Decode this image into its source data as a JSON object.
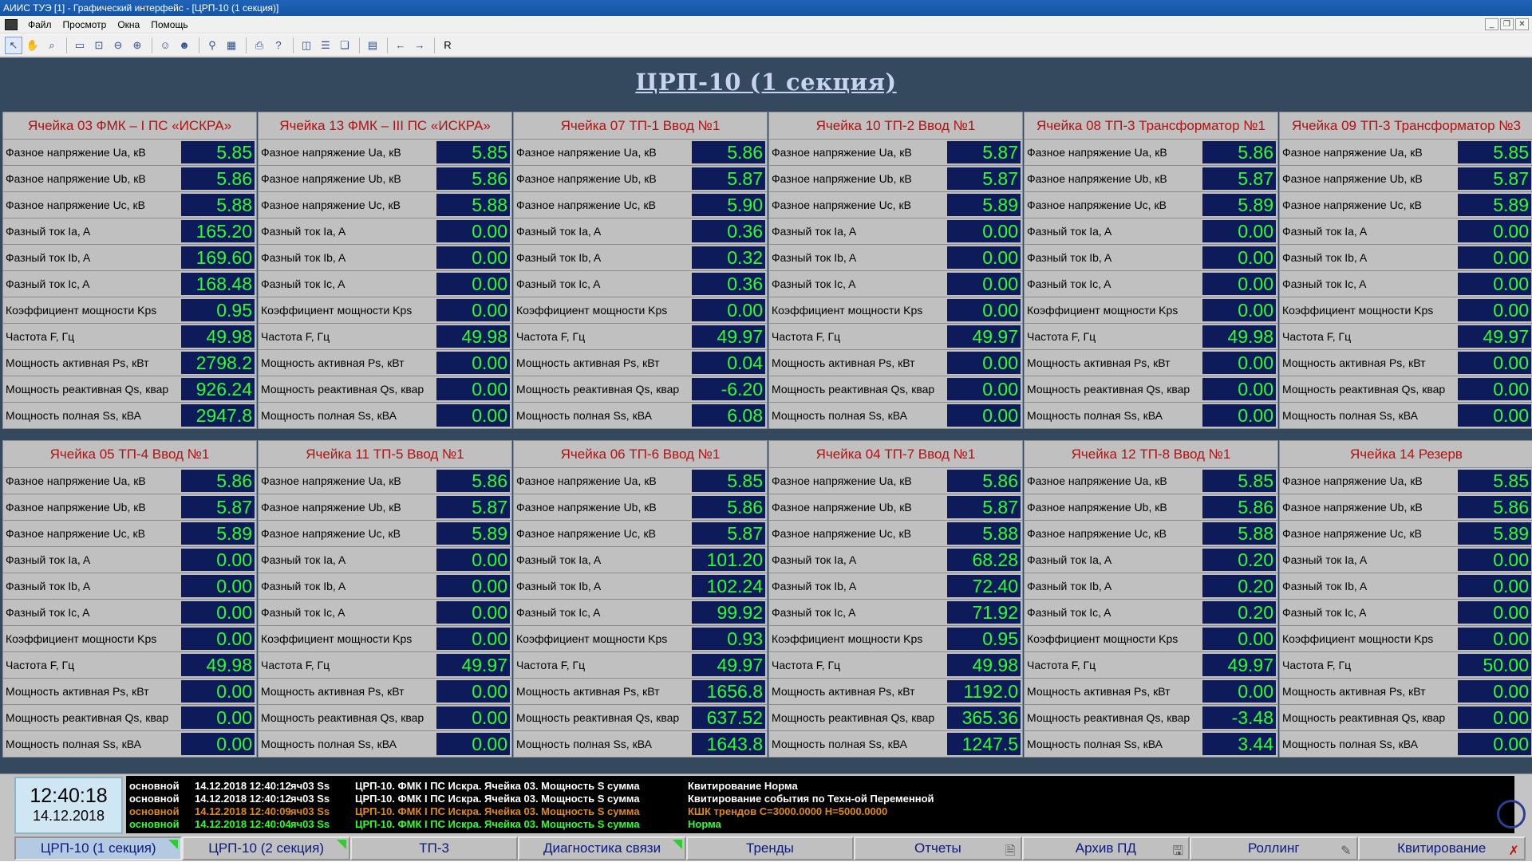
{
  "window": {
    "title": "АИИС ТУЭ [1] - Графический интерфейс - [ЦРП-10 (1 секция)]",
    "menu": [
      "Файл",
      "Просмотр",
      "Окна",
      "Помощь"
    ],
    "toolbar_last_label": "R"
  },
  "page_title": "ЦРП-10 (1 секция)",
  "row_labels": [
    "Фазное напряжение Ua, кВ",
    "Фазное напряжение Ub, кВ",
    "Фазное напряжение Uc, кВ",
    "Фазный ток Ia, A",
    "Фазный ток Ib, A",
    "Фазный ток Ic, A",
    "Коэффициент мощности Kps",
    "Частота F, Гц",
    "Мощность активная Ps, кВт",
    "Мощность реактивная Qs, квар",
    "Мощность полная Ss, кВА"
  ],
  "cells": [
    {
      "title": "Ячейка 03 ФМК – I ПС «ИСКРА»",
      "values": [
        "5.85",
        "5.86",
        "5.88",
        "165.20",
        "169.60",
        "168.48",
        "0.95",
        "49.98",
        "2798.2",
        "926.24",
        "2947.8"
      ]
    },
    {
      "title": "Ячейка 13 ФМК – III ПС «ИСКРА»",
      "values": [
        "5.85",
        "5.86",
        "5.88",
        "0.00",
        "0.00",
        "0.00",
        "0.00",
        "49.98",
        "0.00",
        "0.00",
        "0.00"
      ]
    },
    {
      "title": "Ячейка 07 ТП-1 Ввод №1",
      "values": [
        "5.86",
        "5.87",
        "5.90",
        "0.36",
        "0.32",
        "0.36",
        "0.00",
        "49.97",
        "0.04",
        "-6.20",
        "6.08"
      ]
    },
    {
      "title": "Ячейка 10 ТП-2 Ввод №1",
      "values": [
        "5.87",
        "5.87",
        "5.89",
        "0.00",
        "0.00",
        "0.00",
        "0.00",
        "49.97",
        "0.00",
        "0.00",
        "0.00"
      ]
    },
    {
      "title": "Ячейка 08 ТП-3 Трансформатор №1",
      "values": [
        "5.86",
        "5.87",
        "5.89",
        "0.00",
        "0.00",
        "0.00",
        "0.00",
        "49.98",
        "0.00",
        "0.00",
        "0.00"
      ]
    },
    {
      "title": "Ячейка 09 ТП-3 Трансформатор №3",
      "values": [
        "5.85",
        "5.87",
        "5.89",
        "0.00",
        "0.00",
        "0.00",
        "0.00",
        "49.97",
        "0.00",
        "0.00",
        "0.00"
      ]
    },
    {
      "title": "Ячейка 05 ТП-4 Ввод №1",
      "values": [
        "5.86",
        "5.87",
        "5.89",
        "0.00",
        "0.00",
        "0.00",
        "0.00",
        "49.98",
        "0.00",
        "0.00",
        "0.00"
      ]
    },
    {
      "title": "Ячейка 11 ТП-5 Ввод №1",
      "values": [
        "5.86",
        "5.87",
        "5.89",
        "0.00",
        "0.00",
        "0.00",
        "0.00",
        "49.97",
        "0.00",
        "0.00",
        "0.00"
      ]
    },
    {
      "title": "Ячейка 06 ТП-6 Ввод №1",
      "values": [
        "5.85",
        "5.86",
        "5.87",
        "101.20",
        "102.24",
        "99.92",
        "0.93",
        "49.97",
        "1656.8",
        "637.52",
        "1643.8"
      ]
    },
    {
      "title": "Ячейка 04 ТП-7 Ввод №1",
      "values": [
        "5.86",
        "5.87",
        "5.88",
        "68.28",
        "72.40",
        "71.92",
        "0.95",
        "49.98",
        "1192.0",
        "365.36",
        "1247.5"
      ]
    },
    {
      "title": "Ячейка 12 ТП-8 Ввод №1",
      "values": [
        "5.85",
        "5.86",
        "5.88",
        "0.20",
        "0.20",
        "0.20",
        "0.00",
        "49.97",
        "0.00",
        "-3.48",
        "3.44"
      ]
    },
    {
      "title": "Ячейка 14 Резерв",
      "values": [
        "5.85",
        "5.86",
        "5.89",
        "0.00",
        "0.00",
        "0.00",
        "0.00",
        "50.00",
        "0.00",
        "0.00",
        "0.00"
      ]
    }
  ],
  "clock": {
    "time": "12:40:18",
    "date": "14.12.2018"
  },
  "events": [
    {
      "type": "основной",
      "datetime": "14.12.2018 12:40:12",
      "tag": "яч03 Ss",
      "source": "ЦРП-10. ФМК I ПС Искра. Ячейка 03. Мощность S сумма",
      "message": "Квитирование Норма",
      "color": "white"
    },
    {
      "type": "основной",
      "datetime": "14.12.2018 12:40:12",
      "tag": "яч03 Ss",
      "source": "ЦРП-10. ФМК I ПС Искра. Ячейка 03. Мощность S сумма",
      "message": "Квитирование события по Техн-ой Переменной",
      "color": "white"
    },
    {
      "type": "основной",
      "datetime": "14.12.2018 12:40:09",
      "tag": "яч03 Ss",
      "source": "ЦРП-10. ФМК I ПС Искра. Ячейка 03. Мощность S сумма",
      "message": "КШК трендов C=3000.0000 H=5000.0000",
      "color": "orange"
    },
    {
      "type": "основной",
      "datetime": "14.12.2018 12:40:04",
      "tag": "яч03 Ss",
      "source": "ЦРП-10. ФМК I ПС Искра. Ячейка 03. Мощность S сумма",
      "message": "Норма",
      "color": "green"
    }
  ],
  "tabs": [
    {
      "label": "ЦРП-10 (1 секция)",
      "active": true,
      "flag": true,
      "icon": ""
    },
    {
      "label": "ЦРП-10 (2 секция)",
      "active": false,
      "flag": true,
      "icon": ""
    },
    {
      "label": "ТП-3",
      "active": false,
      "flag": false,
      "icon": ""
    },
    {
      "label": "Диагностика связи",
      "active": false,
      "flag": true,
      "icon": ""
    },
    {
      "label": "Тренды",
      "active": false,
      "flag": false,
      "icon": ""
    },
    {
      "label": "Отчеты",
      "active": false,
      "flag": false,
      "icon": "reports-icon"
    },
    {
      "label": "Архив ПД",
      "active": false,
      "flag": false,
      "icon": "archive-icon"
    },
    {
      "label": "Роллинг",
      "active": false,
      "flag": false,
      "icon": "rolling-icon"
    },
    {
      "label": "Квитирование",
      "active": false,
      "flag": false,
      "icon": "ack-icon"
    }
  ],
  "colors": {
    "panel_bg": "#34495e",
    "value_bg": "#0d1b5a",
    "value_text": "#2bff2b",
    "header_text": "#b01212"
  }
}
